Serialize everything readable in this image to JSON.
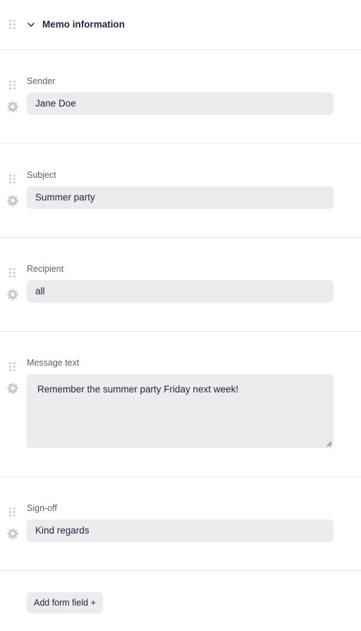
{
  "section": {
    "title": "Memo information",
    "icons": {
      "collapse": "chevron-down-icon",
      "drag": "drag-handle-icon",
      "settings": "gear-icon"
    }
  },
  "fields": [
    {
      "label": "Sender",
      "value": "Jane Doe"
    },
    {
      "label": "Subject",
      "value": "Summer party"
    },
    {
      "label": "Recipient",
      "value": "all"
    },
    {
      "label": "Message text",
      "value": "Remember the summer party Friday next week!"
    },
    {
      "label": "Sign-off",
      "value": "Kind regards"
    }
  ],
  "actions": {
    "add_field": "Add form field +"
  },
  "colors": {
    "field_bg": "#ebecee",
    "divider": "#e6e7ea",
    "text": "#1f2340",
    "label": "#5b6075",
    "icon": "#c9ccd3"
  }
}
